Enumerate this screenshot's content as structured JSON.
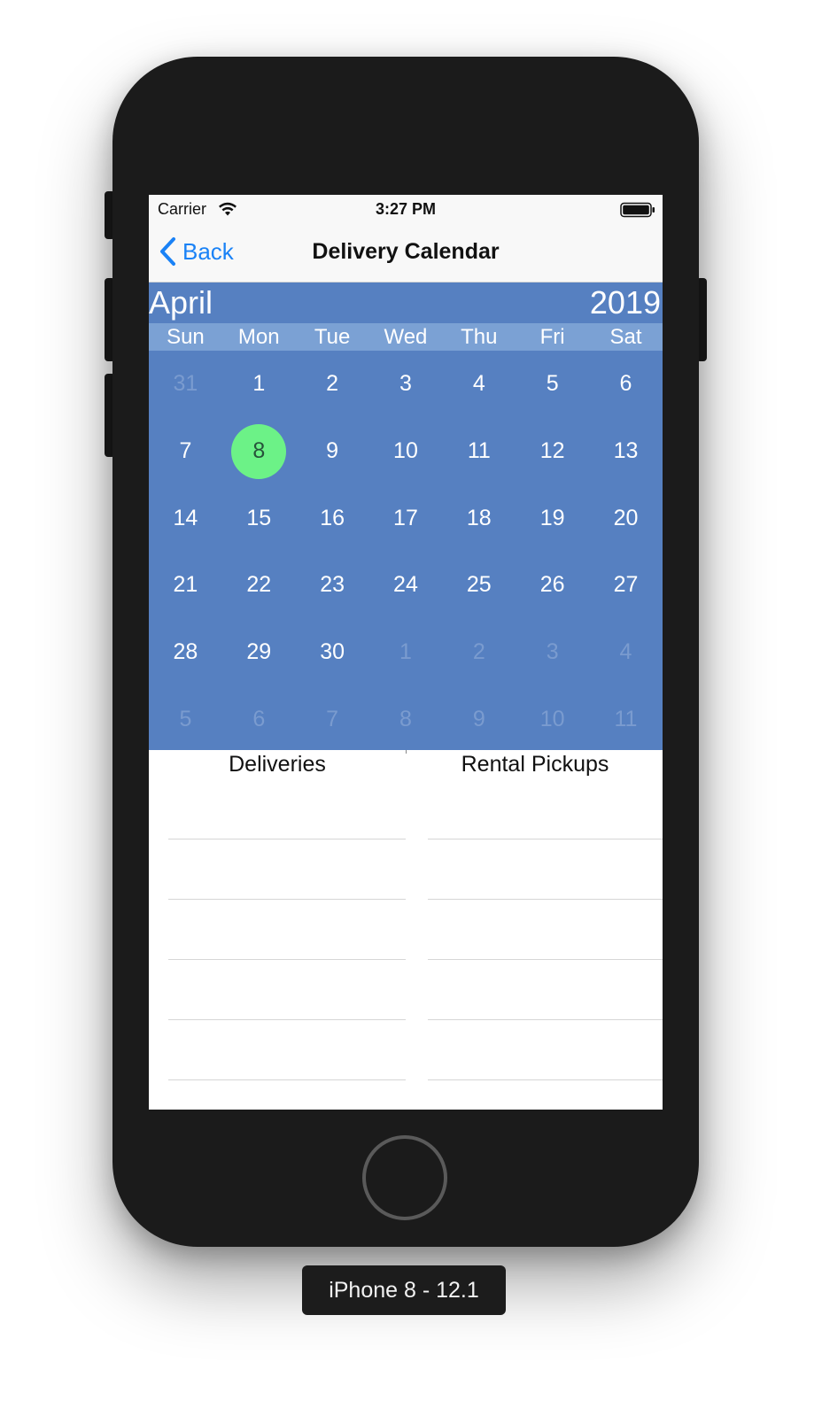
{
  "status_bar": {
    "carrier": "Carrier",
    "time": "3:27 PM"
  },
  "nav": {
    "back_label": "Back",
    "title": "Delivery Calendar"
  },
  "calendar": {
    "month": "April",
    "year": "2019",
    "weekdays": [
      "Sun",
      "Mon",
      "Tue",
      "Wed",
      "Thu",
      "Fri",
      "Sat"
    ],
    "selected_day": "8",
    "weeks": [
      [
        {
          "d": "31",
          "out": true
        },
        {
          "d": "1"
        },
        {
          "d": "2"
        },
        {
          "d": "3"
        },
        {
          "d": "4"
        },
        {
          "d": "5"
        },
        {
          "d": "6"
        }
      ],
      [
        {
          "d": "7"
        },
        {
          "d": "8",
          "selected": true
        },
        {
          "d": "9"
        },
        {
          "d": "10"
        },
        {
          "d": "11"
        },
        {
          "d": "12"
        },
        {
          "d": "13"
        }
      ],
      [
        {
          "d": "14"
        },
        {
          "d": "15"
        },
        {
          "d": "16"
        },
        {
          "d": "17"
        },
        {
          "d": "18"
        },
        {
          "d": "19"
        },
        {
          "d": "20"
        }
      ],
      [
        {
          "d": "21"
        },
        {
          "d": "22"
        },
        {
          "d": "23"
        },
        {
          "d": "24"
        },
        {
          "d": "25"
        },
        {
          "d": "26"
        },
        {
          "d": "27"
        }
      ],
      [
        {
          "d": "28"
        },
        {
          "d": "29"
        },
        {
          "d": "30"
        },
        {
          "d": "1",
          "out": true
        },
        {
          "d": "2",
          "out": true
        },
        {
          "d": "3",
          "out": true
        },
        {
          "d": "4",
          "out": true
        }
      ],
      [
        {
          "d": "5",
          "out": true
        },
        {
          "d": "6",
          "out": true
        },
        {
          "d": "7",
          "out": true
        },
        {
          "d": "8",
          "out": true
        },
        {
          "d": "9",
          "out": true
        },
        {
          "d": "10",
          "out": true
        },
        {
          "d": "11",
          "out": true
        }
      ]
    ],
    "colors": {
      "background": "#5680c1",
      "weekday_bar": "#7ba1d4",
      "selected": "#6cf287"
    }
  },
  "lists": {
    "deliveries_title": "Deliveries",
    "pickups_title": "Rental Pickups"
  },
  "device_label": "iPhone 8 - 12.1",
  "icons": [
    "wifi-icon",
    "battery-icon",
    "back-chevron-icon",
    "home-button"
  ]
}
